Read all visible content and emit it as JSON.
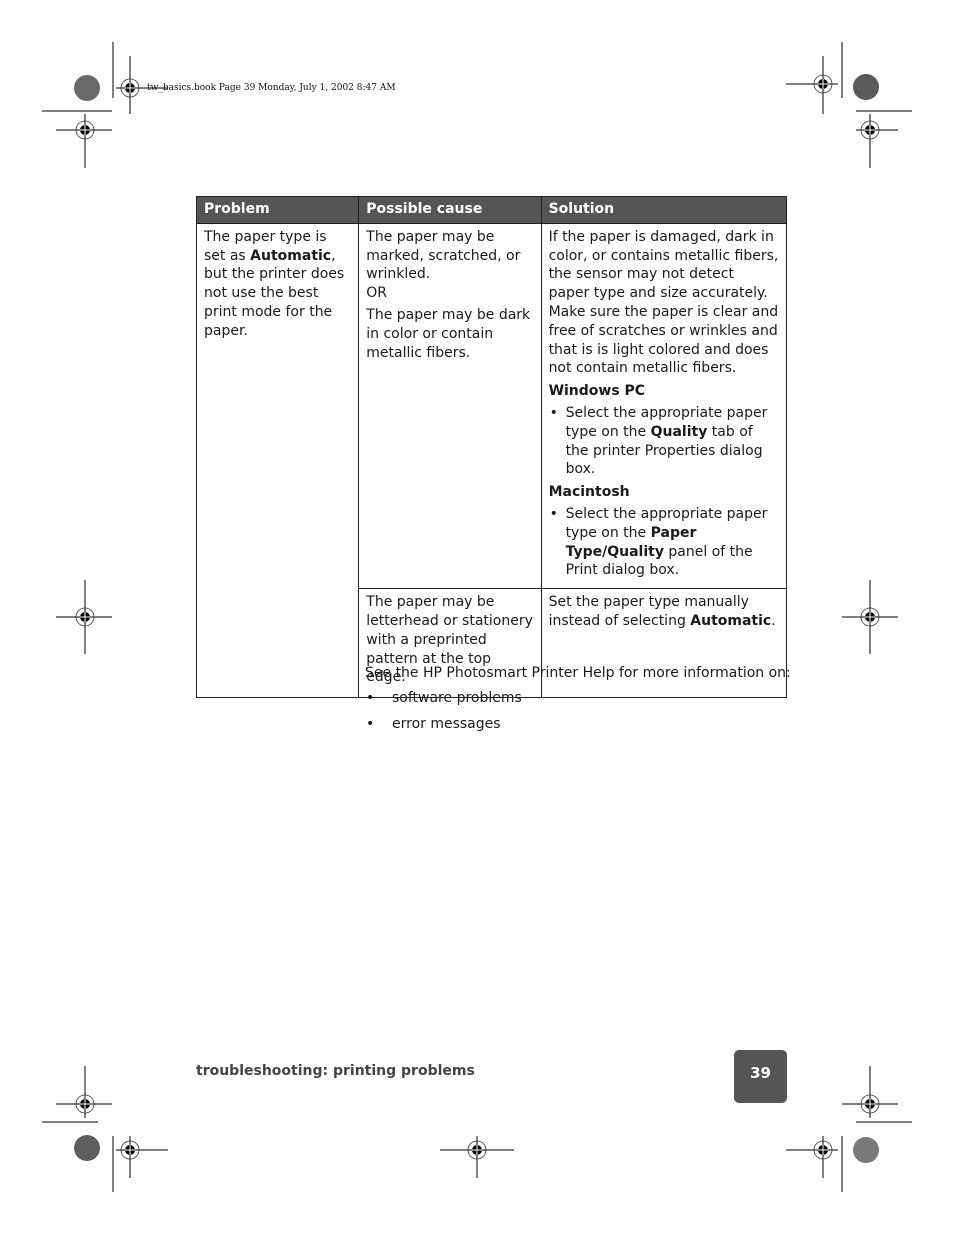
{
  "print_slug": "tw_basics.book  Page 39  Monday, July 1, 2002  8:47 AM",
  "table": {
    "headers": [
      "Problem",
      "Possible cause",
      "Solution"
    ],
    "problem": {
      "pre": "The paper type is set as ",
      "bold": "Automatic",
      "post": ", but the printer does not use the best print mode for the paper."
    },
    "row1": {
      "cause_a": "The paper may be marked, scratched, or wrinkled.",
      "cause_or": "OR",
      "cause_b": "The paper may be dark in color or contain metallic fibers.",
      "solution_intro": "If the paper is damaged, dark in color, or contains metallic fibers, the sensor may not detect paper type and size accurately. Make sure the paper is clear and free of scratches or wrinkles and that is is light colored and does not contain metallic fibers.",
      "windows_heading": "Windows PC",
      "windows_pre": "Select the appropriate paper type on the ",
      "windows_bold": "Quality",
      "windows_post": " tab of the printer Properties dialog box.",
      "mac_heading": "Macintosh",
      "mac_pre": "Select the appropriate paper type on the ",
      "mac_bold": "Paper Type/Quality",
      "mac_post": " panel of the Print dialog box."
    },
    "row2": {
      "cause": "The paper may be letterhead or stationery with a preprinted pattern at the top edge.",
      "solution_pre": "Set the paper type manually instead of selecting ",
      "solution_bold": "Automatic",
      "solution_post": "."
    }
  },
  "more_info": {
    "lead": "See the HP Photosmart Printer Help for more information on:",
    "items": [
      "software problems",
      "error messages"
    ]
  },
  "footer": {
    "section_title": "troubleshooting: printing problems",
    "page_number": "39"
  },
  "colors": {
    "header_fill": "#555555",
    "page_tab_fill": "#555555"
  }
}
